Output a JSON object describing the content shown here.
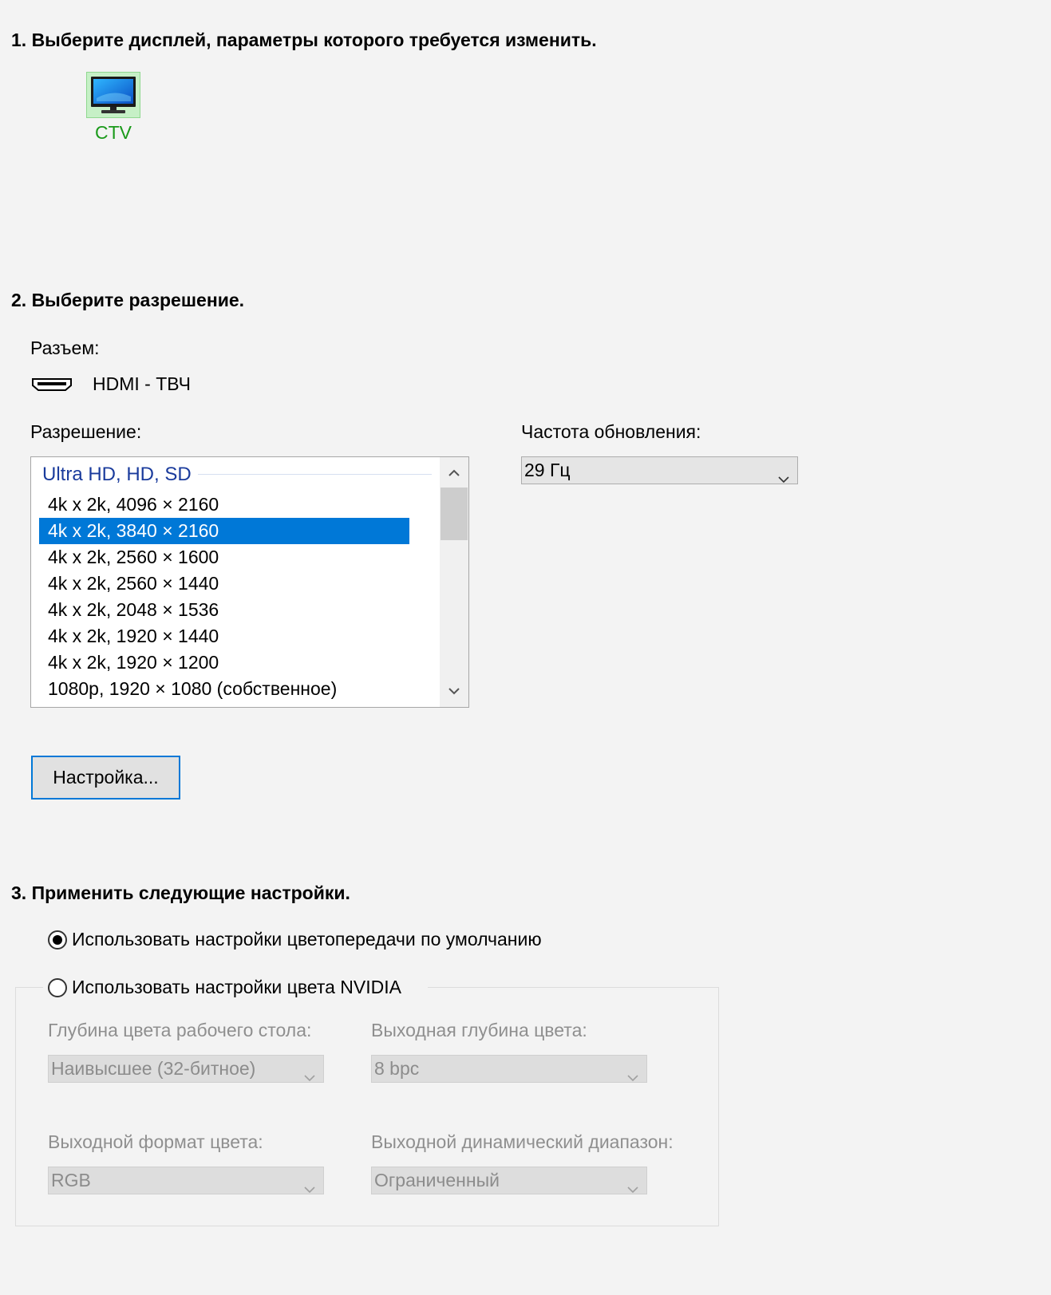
{
  "step1": {
    "title": "1. Выберите дисплей, параметры которого требуется изменить.",
    "display_name": "CTV"
  },
  "step2": {
    "title": "2. Выберите разрешение.",
    "connector_label": "Разъем:",
    "connector_value": "HDMI - ТВЧ",
    "resolution_label": "Разрешение:",
    "refresh_label": "Частота обновления:",
    "refresh_value": "29 Гц",
    "resolution_group": "Ultra HD, HD, SD",
    "resolutions": [
      "4k x 2k, 4096 × 2160",
      "4k x 2k, 3840 × 2160",
      "4k x 2k, 2560 × 1600",
      "4k x 2k, 2560 × 1440",
      "4k x 2k, 2048 × 1536",
      "4k x 2k, 1920 × 1440",
      "4k x 2k, 1920 × 1200",
      "1080p, 1920 × 1080 (собственное)"
    ],
    "selected_resolution": "4k x 2k, 3840 × 2160",
    "customize_button": "Настройка..."
  },
  "step3": {
    "title": "3. Применить следующие настройки.",
    "radio_default": "Использовать настройки цветопередачи по умолчанию",
    "radio_nvidia": "Использовать настройки цвета NVIDIA",
    "selected_radio": "default",
    "desktop_depth_label": "Глубина цвета рабочего стола:",
    "desktop_depth_value": "Наивысшее (32-битное)",
    "output_depth_label": "Выходная глубина цвета:",
    "output_depth_value": "8 bpc",
    "output_format_label": "Выходной формат цвета:",
    "output_format_value": "RGB",
    "dynamic_range_label": "Выходной динамический диапазон:",
    "dynamic_range_value": "Ограниченный"
  },
  "colors": {
    "accent": "#0078d7",
    "group_header": "#1a3b9c",
    "display_name": "#1a9a1a"
  }
}
